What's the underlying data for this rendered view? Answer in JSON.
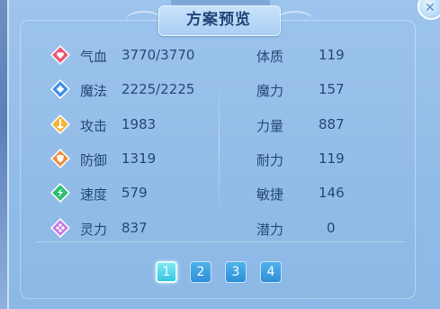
{
  "title": "方案预览",
  "close_icon": "close-icon",
  "colors": {
    "panel_bg": "#92bce8",
    "text": "#25487a",
    "page_btn": "#2f8fd8",
    "page_btn_active": "#35c6e3"
  },
  "stats": [
    {
      "label": "气血",
      "value": "3770/3770",
      "icon": "heart-icon",
      "color": "#e85a76"
    },
    {
      "label": "魔法",
      "value": "2225/2225",
      "icon": "mana-icon",
      "color": "#3f8fe6"
    },
    {
      "label": "攻击",
      "value": "1983",
      "icon": "attack-icon",
      "color": "#f2b63a"
    },
    {
      "label": "防御",
      "value": "1319",
      "icon": "defense-icon",
      "color": "#ef8a3c"
    },
    {
      "label": "速度",
      "value": "579",
      "icon": "speed-icon",
      "color": "#2fbf6f"
    },
    {
      "label": "灵力",
      "value": "837",
      "icon": "spirit-icon",
      "color": "#c77be0"
    }
  ],
  "attributes": [
    {
      "label": "体质",
      "value": "119"
    },
    {
      "label": "魔力",
      "value": "157"
    },
    {
      "label": "力量",
      "value": "887"
    },
    {
      "label": "耐力",
      "value": "119"
    },
    {
      "label": "敏捷",
      "value": "146"
    },
    {
      "label": "潜力",
      "value": "0"
    }
  ],
  "pages": [
    "1",
    "2",
    "3",
    "4"
  ],
  "active_page": "1"
}
